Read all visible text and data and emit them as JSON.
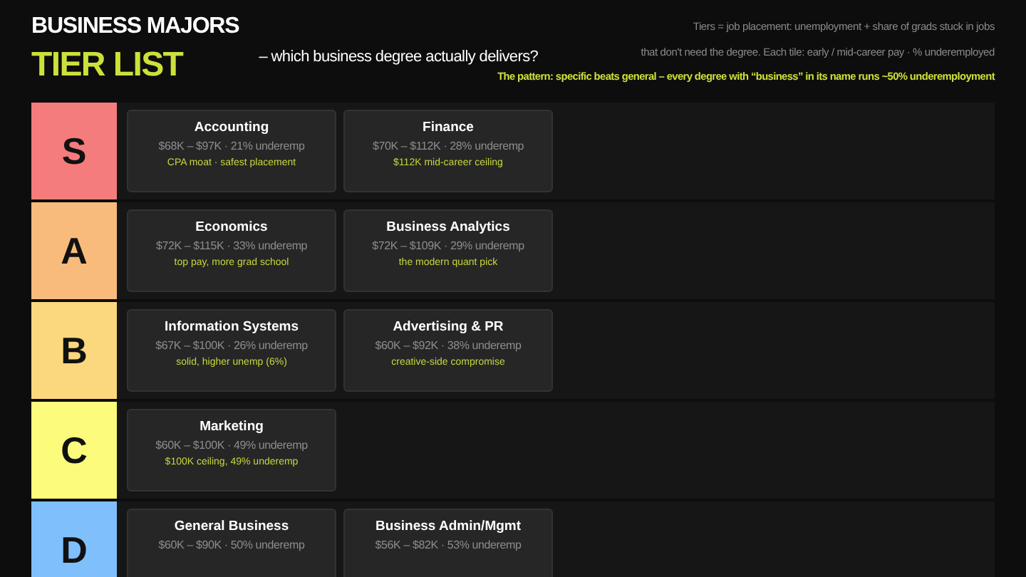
{
  "header": {
    "title": "BUSINESS MAJORS",
    "subtitle": "TIER LIST",
    "tagline": "– which business degree actually delivers?",
    "notes": [
      "Tiers = job placement: unemployment + share of grads stuck in jobs",
      "that don't need the degree. Each tile: early / mid-career pay · % underemployed"
    ],
    "pattern": "The pattern: specific beats general – every degree with “business” in its name runs ~50% underemployment"
  },
  "tiers": [
    {
      "label": "S",
      "color": "#f47c7c",
      "tiles": [
        {
          "name": "Accounting",
          "stats": "$68K – $97K · 21% underemp",
          "note": "CPA moat · safest placement"
        },
        {
          "name": "Finance",
          "stats": "$70K – $112K · 28% underemp",
          "note": "$112K mid-career ceiling"
        }
      ]
    },
    {
      "label": "A",
      "color": "#f8bb7c",
      "tiles": [
        {
          "name": "Economics",
          "stats": "$72K – $115K · 33% underemp",
          "note": "top pay, more grad school"
        },
        {
          "name": "Business Analytics",
          "stats": "$72K – $109K · 29% underemp",
          "note": "the modern quant pick"
        }
      ]
    },
    {
      "label": "B",
      "color": "#fbd77e",
      "tiles": [
        {
          "name": "Information Systems",
          "stats": "$67K – $100K · 26% underemp",
          "note": "solid, higher unemp (6%)"
        },
        {
          "name": "Advertising & PR",
          "stats": "$60K – $92K · 38% underemp",
          "note": "creative-side compromise"
        }
      ]
    },
    {
      "label": "C",
      "color": "#fcfb7c",
      "tiles": [
        {
          "name": "Marketing",
          "stats": "$60K – $100K · 49% underemp",
          "note": "$100K ceiling, 49% underemp"
        }
      ]
    },
    {
      "label": "D",
      "color": "#7fbffc",
      "tiles": [
        {
          "name": "General Business",
          "stats": "$60K – $90K · 50% underemp"
        },
        {
          "name": "Business Admin/Mgmt",
          "stats": "$56K – $82K · 53% underemp"
        }
      ]
    }
  ]
}
